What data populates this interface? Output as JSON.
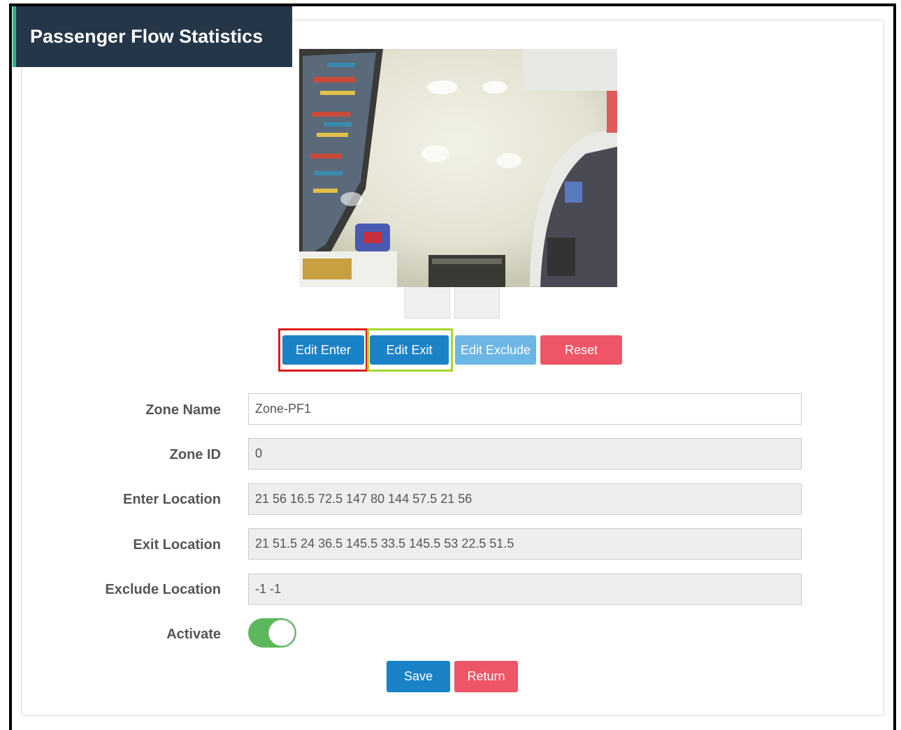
{
  "header": {
    "title": "Passenger Flow Statistics"
  },
  "camera": {
    "alt": "overhead fisheye camera view"
  },
  "zone_buttons": {
    "edit_enter": "Edit Enter",
    "edit_exit": "Edit Exit",
    "edit_exclude": "Edit Exclude",
    "reset": "Reset"
  },
  "form": {
    "zone_name": {
      "label": "Zone Name",
      "value": "Zone-PF1"
    },
    "zone_id": {
      "label": "Zone ID",
      "value": "0"
    },
    "enter_location": {
      "label": "Enter Location",
      "value": "21 56 16.5 72.5 147 80 144 57.5 21 56"
    },
    "exit_location": {
      "label": "Exit Location",
      "value": "21 51.5 24 36.5 145.5 33.5 145.5 53 22.5 51.5"
    },
    "exclude_location": {
      "label": "Exclude Location",
      "value": "-1 -1"
    },
    "activate": {
      "label": "Activate",
      "on": true
    }
  },
  "actions": {
    "save": "Save",
    "return": "Return"
  },
  "colors": {
    "header_bg": "#243647",
    "header_accent": "#2bb48a",
    "primary": "#1a82c7",
    "primary_light": "#6cb6e6",
    "danger": "#ee5566",
    "toggle_on": "#5cb85c",
    "highlight_red": "#e21a1a",
    "highlight_green": "#a6d72a"
  }
}
